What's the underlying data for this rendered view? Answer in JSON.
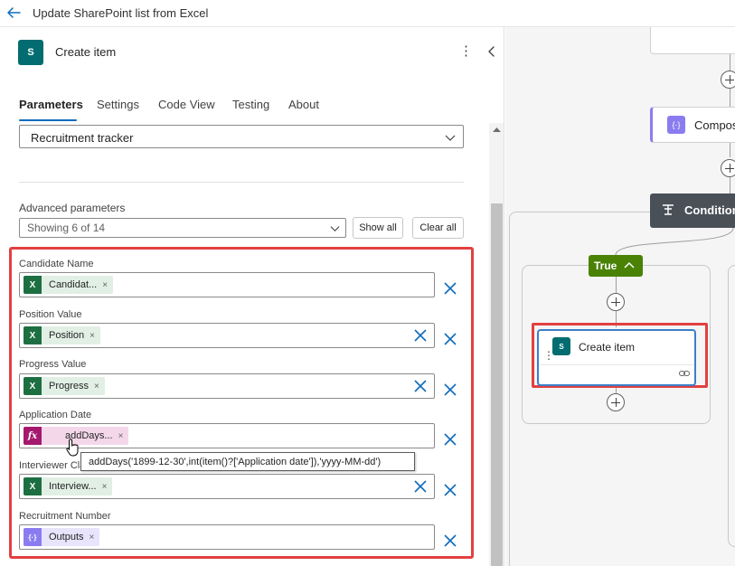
{
  "window": {
    "title": "Update SharePoint list from Excel"
  },
  "panel": {
    "logo_text": "S",
    "title": "Create item",
    "more_glyph": "⋮",
    "tabs": [
      {
        "label": "Parameters",
        "active": true
      },
      {
        "label": "Settings",
        "active": false
      },
      {
        "label": "Code View",
        "active": false
      },
      {
        "label": "Testing",
        "active": false
      },
      {
        "label": "About",
        "active": false
      }
    ],
    "list_name": {
      "value": "Recruitment tracker"
    },
    "advanced": {
      "label": "Advanced parameters",
      "dropdown_value": "Showing 6 of 14",
      "show_all_label": "Show all",
      "clear_all_label": "Clear all"
    },
    "fields": [
      {
        "label": "Candidate Name",
        "token_text": "Candidat...",
        "token_type": "excel"
      },
      {
        "label": "Position Value",
        "token_text": "Position",
        "token_type": "excel"
      },
      {
        "label": "Progress Value",
        "token_text": "Progress",
        "token_type": "excel"
      },
      {
        "label": "Application Date",
        "token_text": "addDays...",
        "token_type": "expression"
      },
      {
        "label": "Interviewer Cla",
        "token_text": "Interview...",
        "token_type": "excel"
      },
      {
        "label": "Recruitment Number",
        "token_text": "Outputs",
        "token_type": "compose"
      }
    ],
    "token_remove_glyph": "×",
    "expression_icon_text": "fx",
    "excel_icon_text": "X",
    "compose_icon_text": "{·}",
    "tooltip": "addDays('1899-12-30',int(item()?['Application date']),'yyyy-MM-dd')"
  },
  "canvas": {
    "compose_label": "Compos",
    "compose_icon_text": "{·}",
    "condition_label": "Condition",
    "true_label": "True",
    "create_item_label": "Create item",
    "create_item_icon_text": "S",
    "drag_glyph": "⋮"
  },
  "colors": {
    "accent": "#0f6cbd",
    "highlight": "#e24040",
    "excel": "#1d6f42",
    "sharepoint": "#036c70",
    "expression": "#a5186d",
    "compose": "#8a7cf0",
    "true_branch": "#498205",
    "condition": "#4a5058"
  }
}
